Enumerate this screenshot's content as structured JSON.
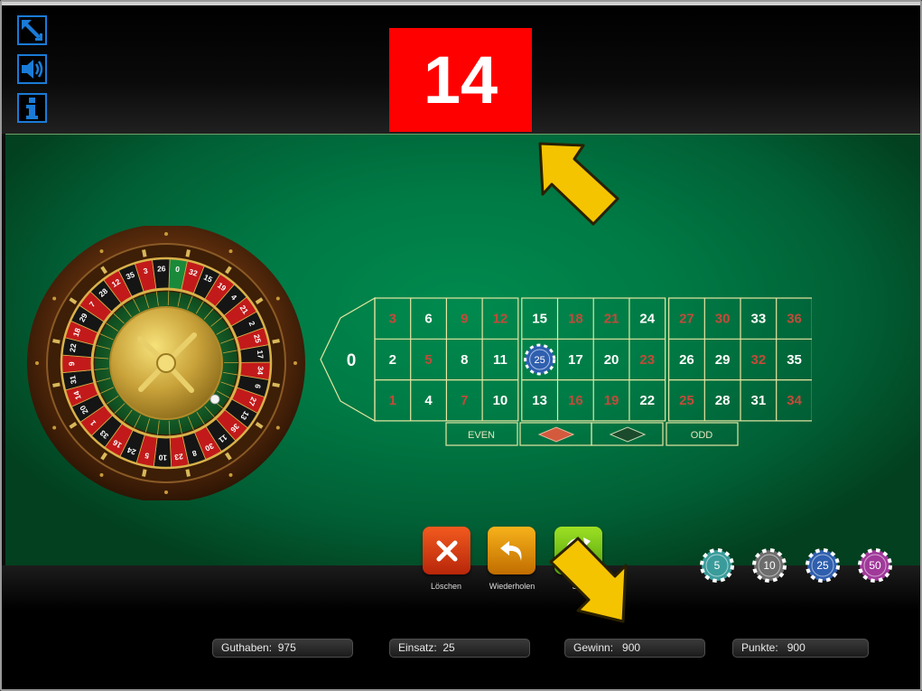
{
  "app": {
    "top_icons": [
      "fullscreen-icon",
      "sound-icon",
      "info-icon"
    ],
    "result_number": "14",
    "result_color": "#ff0000"
  },
  "wheel": {
    "numbers": [
      "0",
      "32",
      "15",
      "19",
      "4",
      "21",
      "2",
      "25",
      "17",
      "34",
      "6",
      "27",
      "13",
      "36",
      "11",
      "30",
      "8",
      "23",
      "10",
      "5",
      "24",
      "16",
      "33",
      "1",
      "20",
      "14",
      "31",
      "9",
      "22",
      "18",
      "29",
      "7",
      "28",
      "12",
      "35",
      "3",
      "26"
    ]
  },
  "table": {
    "zero": "0",
    "rows": [
      [
        "3",
        "6",
        "9",
        "12",
        "15",
        "18",
        "21",
        "24",
        "27",
        "30",
        "33",
        "36"
      ],
      [
        "2",
        "5",
        "8",
        "11",
        "14",
        "17",
        "20",
        "23",
        "26",
        "29",
        "32",
        "35"
      ],
      [
        "1",
        "4",
        "7",
        "10",
        "13",
        "16",
        "19",
        "22",
        "25",
        "28",
        "31",
        "34"
      ]
    ],
    "red_numbers": [
      "1",
      "3",
      "5",
      "7",
      "9",
      "12",
      "14",
      "16",
      "18",
      "19",
      "21",
      "23",
      "25",
      "27",
      "30",
      "32",
      "34",
      "36"
    ],
    "outside": {
      "even": "EVEN",
      "odd": "ODD"
    },
    "placed_chip": {
      "number": "14",
      "value": "25"
    }
  },
  "controls": {
    "clear_label": "Löschen",
    "repeat_label": "Wiederholen",
    "start_label": "Start"
  },
  "chips": [
    {
      "value": "5",
      "color": "#3a9b9b"
    },
    {
      "value": "10",
      "color": "#6d6d6d"
    },
    {
      "value": "25",
      "color": "#2f5fae"
    },
    {
      "value": "50",
      "color": "#a0399a"
    }
  ],
  "stats": {
    "balance_label": "Guthaben:",
    "balance_value": "975",
    "stake_label": "Einsatz:",
    "stake_value": "25",
    "win_label": "Gewinn:",
    "win_value": "900",
    "points_label": "Punkte:",
    "points_value": "900"
  },
  "colors": {
    "felt": "#007a45",
    "table_line": "#e7e7a3",
    "red_number": "#c24b3a",
    "arrow": "#f5c400"
  }
}
